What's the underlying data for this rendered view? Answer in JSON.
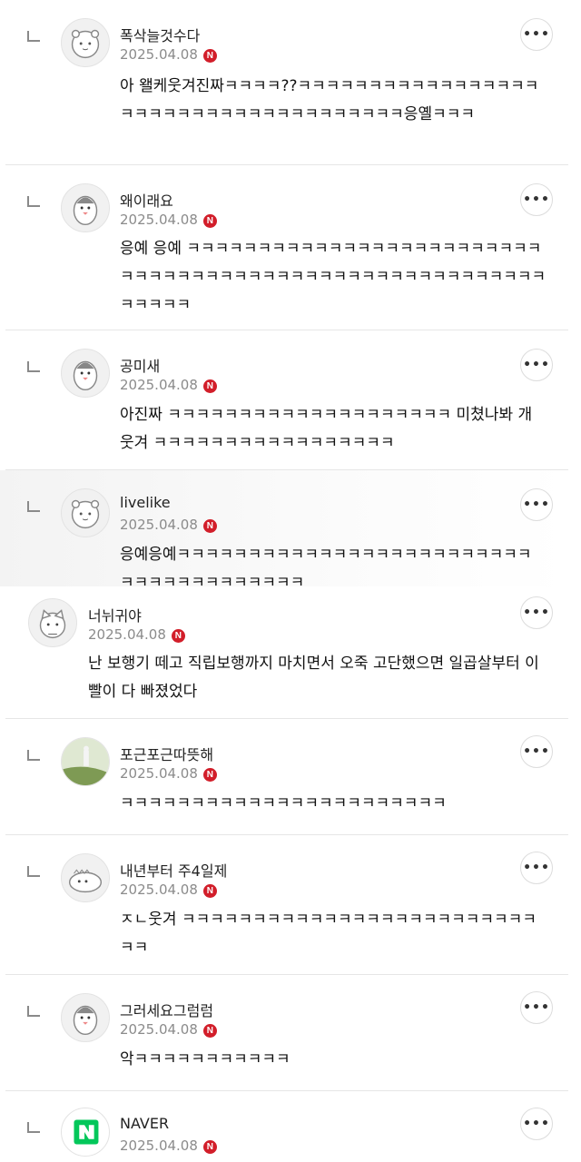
{
  "comments": [
    {
      "nickname": "폭삭늘것수다",
      "date": "2025.04.08",
      "badge": "N",
      "text": "아 왤케웃겨진짜ㅋㅋㅋㅋ??ㅋㅋㅋㅋㅋㅋㅋㅋㅋㅋㅋㅋㅋㅋㅋㅋㅋㅋㅋㅋㅋㅋㅋㅋㅋㅋㅋㅋㅋㅋㅋㅋㅋㅋㅋㅋㅋ응옐ㅋㅋㅋ",
      "is_reply": true,
      "more": "•••"
    },
    {
      "nickname": "왜이래요",
      "date": "2025.04.08",
      "badge": "N",
      "text": "응예 응예 ㅋㅋㅋㅋㅋㅋㅋㅋㅋㅋㅋㅋㅋㅋㅋㅋㅋㅋㅋㅋㅋㅋㅋㅋㅋㅋㅋㅋㅋㅋㅋㅋㅋㅋㅋㅋㅋㅋㅋㅋㅋㅋㅋㅋㅋㅋㅋㅋㅋㅋㅋㅋㅋㅋㅋㅋㅋㅋㅋㅋ",
      "is_reply": true,
      "more": "•••"
    },
    {
      "nickname": "공미새",
      "date": "2025.04.08",
      "badge": "N",
      "text": "아진짜 ㅋㅋㅋㅋㅋㅋㅋㅋㅋㅋㅋㅋㅋㅋㅋㅋㅋㅋㅋㅋ 미쳤나봐 개웃겨 ㅋㅋㅋㅋㅋㅋㅋㅋㅋㅋㅋㅋㅋㅋㅋㅋㅋ",
      "is_reply": true,
      "more": "•••"
    },
    {
      "nickname": "livelike",
      "date": "2025.04.08",
      "badge": "N",
      "text": "응예응예ㅋㅋㅋㅋㅋㅋㅋㅋㅋㅋㅋㅋㅋㅋㅋㅋㅋㅋㅋㅋㅋㅋㅋㅋㅋㅋㅋㅋㅋㅋㅋㅋㅋㅋㅋㅋㅋㅋ",
      "is_reply": true,
      "more": "•••"
    },
    {
      "nickname": "너뉘귀야",
      "date": "2025.04.08",
      "badge": "N",
      "text": "난 보행기 떼고 직립보행까지 마치면서 오죽 고단했으면 일곱살부터 이빨이 다 빠졌었다",
      "is_reply": false,
      "more": "•••"
    },
    {
      "nickname": "포근포근따뜻해",
      "date": "2025.04.08",
      "badge": "N",
      "text": "ㅋㅋㅋㅋㅋㅋㅋㅋㅋㅋㅋㅋㅋㅋㅋㅋㅋㅋㅋㅋㅋㅋㅋ",
      "is_reply": true,
      "more": "•••"
    },
    {
      "nickname": "내년부터 주4일제",
      "date": "2025.04.08",
      "badge": "N",
      "text": "ㅈㄴ웃겨 ㅋㅋㅋㅋㅋㅋㅋㅋㅋㅋㅋㅋㅋㅋㅋㅋㅋㅋㅋㅋㅋㅋㅋㅋㅋㅋㅋ",
      "is_reply": true,
      "more": "•••"
    },
    {
      "nickname": "그러세요그럼럼",
      "date": "2025.04.08",
      "badge": "N",
      "text": "악ㅋㅋㅋㅋㅋㅋㅋㅋㅋㅋㅋ",
      "is_reply": true,
      "more": "•••"
    },
    {
      "nickname": "NAVER",
      "date": "2025.04.08",
      "badge": "N",
      "text": "",
      "is_reply": true,
      "more": "•••"
    }
  ]
}
